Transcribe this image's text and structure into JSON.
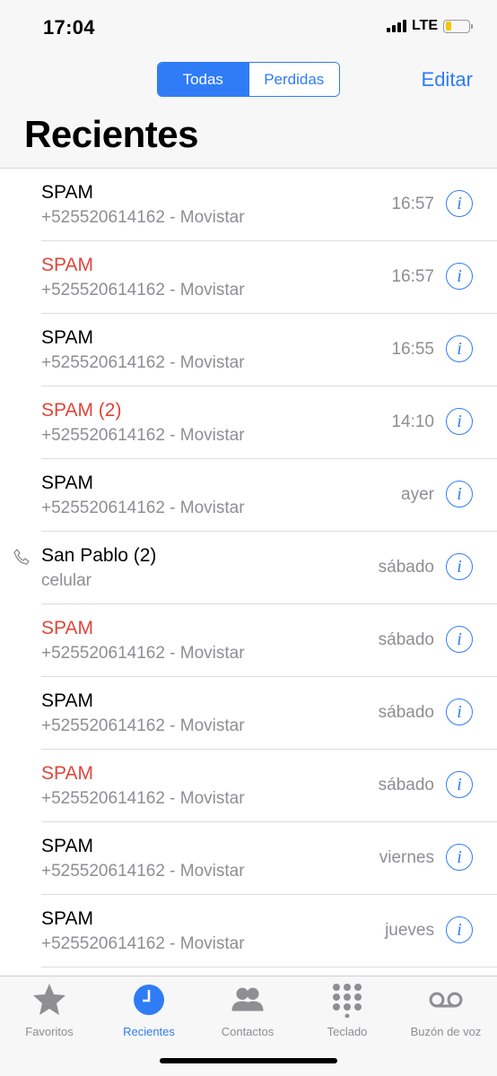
{
  "status": {
    "time": "17:04",
    "network": "LTE",
    "battery_level": 0.25
  },
  "nav": {
    "segments": [
      {
        "label": "Todas",
        "active": true
      },
      {
        "label": "Perdidas",
        "active": false
      }
    ],
    "edit_label": "Editar",
    "title": "Recientes"
  },
  "calls": [
    {
      "name": "SPAM",
      "detail": "+525520614162 - Movistar",
      "time": "16:57",
      "missed": false,
      "outgoing": false
    },
    {
      "name": "SPAM",
      "detail": "+525520614162 - Movistar",
      "time": "16:57",
      "missed": true,
      "outgoing": false
    },
    {
      "name": "SPAM",
      "detail": "+525520614162 - Movistar",
      "time": "16:55",
      "missed": false,
      "outgoing": false
    },
    {
      "name": "SPAM (2)",
      "detail": "+525520614162 - Movistar",
      "time": "14:10",
      "missed": true,
      "outgoing": false
    },
    {
      "name": "SPAM",
      "detail": "+525520614162 - Movistar",
      "time": "ayer",
      "missed": false,
      "outgoing": false
    },
    {
      "name": "San Pablo (2)",
      "detail": "celular",
      "time": "sábado",
      "missed": false,
      "outgoing": true
    },
    {
      "name": "SPAM",
      "detail": "+525520614162 - Movistar",
      "time": "sábado",
      "missed": true,
      "outgoing": false
    },
    {
      "name": "SPAM",
      "detail": "+525520614162 - Movistar",
      "time": "sábado",
      "missed": false,
      "outgoing": false
    },
    {
      "name": "SPAM",
      "detail": "+525520614162 - Movistar",
      "time": "sábado",
      "missed": true,
      "outgoing": false
    },
    {
      "name": "SPAM",
      "detail": "+525520614162 - Movistar",
      "time": "viernes",
      "missed": false,
      "outgoing": false
    },
    {
      "name": "SPAM",
      "detail": "+525520614162 - Movistar",
      "time": "jueves",
      "missed": false,
      "outgoing": false
    }
  ],
  "tabs": [
    {
      "label": "Favoritos",
      "icon": "star-icon",
      "active": false
    },
    {
      "label": "Recientes",
      "icon": "clock-icon",
      "active": true
    },
    {
      "label": "Contactos",
      "icon": "contacts-icon",
      "active": false
    },
    {
      "label": "Teclado",
      "icon": "keypad-icon",
      "active": false
    },
    {
      "label": "Buzón de voz",
      "icon": "voicemail-icon",
      "active": false
    }
  ],
  "colors": {
    "accent": "#2f7cf6",
    "missed": "#e0453a",
    "secondary_text": "#8e8e93",
    "battery": "#f5c400"
  }
}
